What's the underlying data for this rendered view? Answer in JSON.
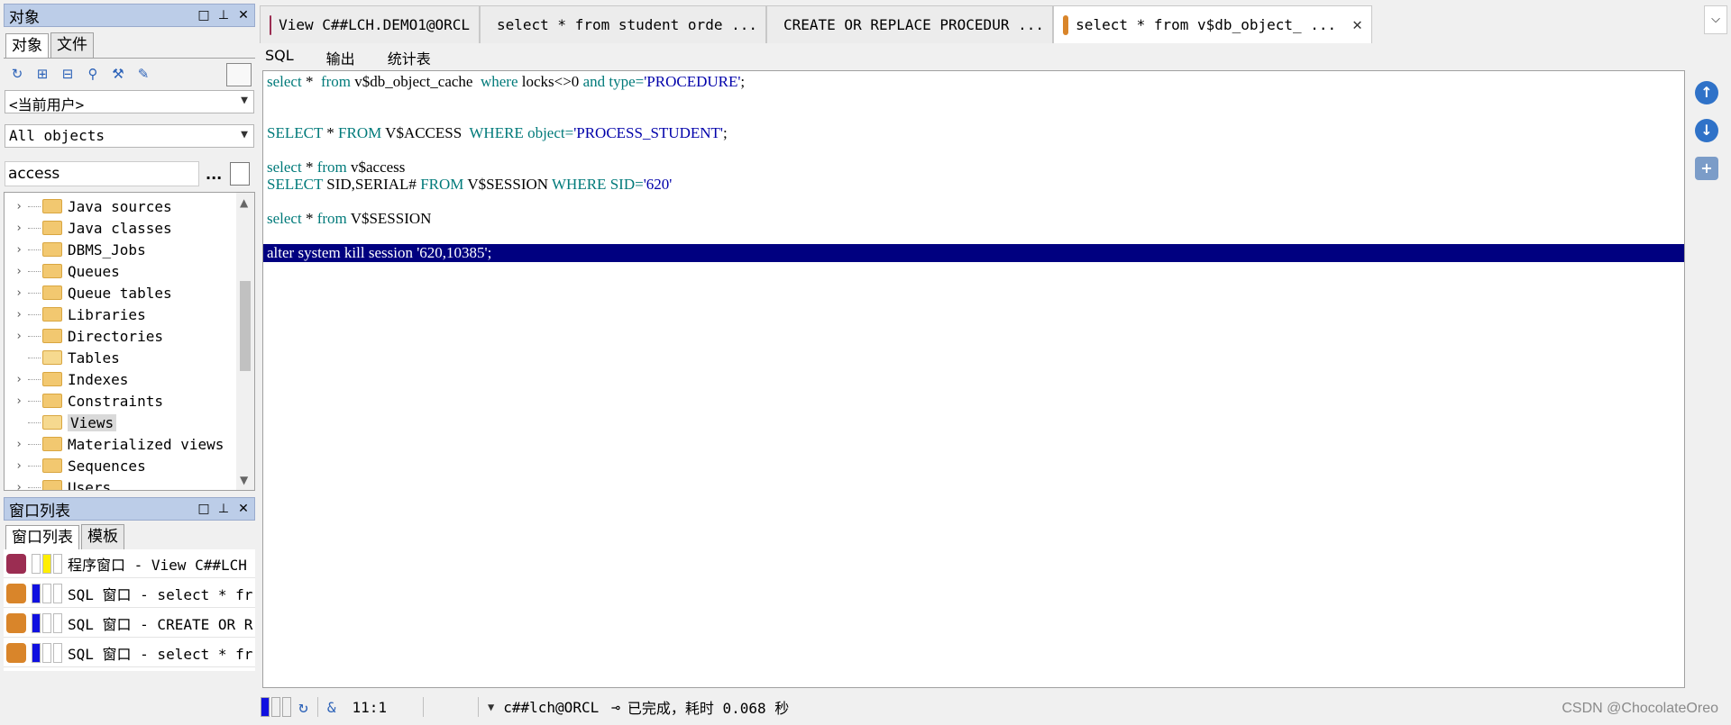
{
  "objects_panel": {
    "title": "对象",
    "controls": [
      "□",
      "⊥",
      "✕"
    ],
    "tabs": [
      {
        "label": "对象",
        "active": true
      },
      {
        "label": "文件",
        "active": false
      }
    ],
    "user_select": "<当前用户>",
    "type_select": "All objects",
    "search_value": "access",
    "search_dots": "...",
    "tree_items": [
      {
        "label": "Java sources",
        "expandable": true,
        "open": false,
        "selected": false
      },
      {
        "label": "Java classes",
        "expandable": true,
        "open": false,
        "selected": false
      },
      {
        "label": "DBMS_Jobs",
        "expandable": true,
        "open": false,
        "selected": false
      },
      {
        "label": "Queues",
        "expandable": true,
        "open": false,
        "selected": false
      },
      {
        "label": "Queue tables",
        "expandable": true,
        "open": false,
        "selected": false
      },
      {
        "label": "Libraries",
        "expandable": true,
        "open": false,
        "selected": false
      },
      {
        "label": "Directories",
        "expandable": true,
        "open": false,
        "selected": false
      },
      {
        "label": "Tables",
        "expandable": false,
        "open": true,
        "selected": false
      },
      {
        "label": "Indexes",
        "expandable": true,
        "open": false,
        "selected": false
      },
      {
        "label": "Constraints",
        "expandable": true,
        "open": false,
        "selected": false
      },
      {
        "label": "Views",
        "expandable": false,
        "open": true,
        "selected": true
      },
      {
        "label": "Materialized views",
        "expandable": true,
        "open": false,
        "selected": false
      },
      {
        "label": "Sequences",
        "expandable": true,
        "open": false,
        "selected": false
      },
      {
        "label": "Users",
        "expandable": true,
        "open": false,
        "selected": false
      }
    ]
  },
  "window_list_panel": {
    "title": "窗口列表",
    "controls": [
      "□",
      "⊥",
      "✕"
    ],
    "tabs": [
      {
        "label": "窗口列表",
        "active": true
      },
      {
        "label": "模板",
        "active": false
      }
    ],
    "rows": [
      {
        "text": "程序窗口 - View C##LCH",
        "icon_color": "#9b2d52",
        "swatch": "#ffee00"
      },
      {
        "text": "SQL 窗口 - select * fr",
        "icon_color": "#d9852a",
        "swatch": "#1010e0"
      },
      {
        "text": "SQL 窗口 - CREATE OR R",
        "icon_color": "#d9852a",
        "swatch": "#1010e0"
      },
      {
        "text": "SQL 窗口 - select * fr",
        "icon_color": "#d9852a",
        "swatch": "#1010e0"
      }
    ]
  },
  "editor_tabs": [
    {
      "label": "View C##LCH.DEMO1@ORCL",
      "icon_color": "#9b2d52",
      "active": false
    },
    {
      "label": "select * from student orde ...",
      "icon_color": "#d9852a",
      "active": false
    },
    {
      "label": "CREATE OR REPLACE PROCEDUR ...",
      "icon_color": "#d9852a",
      "active": false
    },
    {
      "label": "select * from v$db_object_ ...",
      "icon_color": "#d9852a",
      "active": true
    }
  ],
  "editor_tab_close": "✕",
  "sub_tabs": [
    {
      "label": "SQL"
    },
    {
      "label": "输出"
    },
    {
      "label": "统计表"
    }
  ],
  "code": {
    "line1": {
      "a": "select",
      "b": " * ",
      "c": " from",
      "d": " v$db_object_cache  ",
      "e": "where",
      "f": " locks<>0 ",
      "g": "and",
      "h": " type=",
      "i": "'PROCEDURE'",
      "j": ";"
    },
    "line2": {
      "a": "SELECT",
      "b": " * ",
      "c": "FROM",
      "d": " V$ACCESS  ",
      "e": "WHERE",
      "f": " object=",
      "g": "'PROCESS_STUDENT'",
      "h": ";"
    },
    "line3": {
      "a": "select",
      "b": " * ",
      "c": "from",
      "d": " v$access"
    },
    "line4": {
      "a": "SELECT",
      "b": " SID,SERIAL# ",
      "c": "FROM",
      "d": " V$SESSION ",
      "e": "WHERE",
      "f": " SID=",
      "g": "'620'"
    },
    "line5": {
      "a": "select",
      "b": " * ",
      "c": "from",
      "d": " V$SESSION"
    },
    "line6": "alter system kill session '620,10385';"
  },
  "status_bar": {
    "cursor": "11:1",
    "amp": "&",
    "connection": "c##lch@ORCL",
    "message": "已完成，耗时 0.068 秒"
  },
  "watermark": "CSDN @ChocolateOreo",
  "colors": {
    "keyword": "#007a7a",
    "string": "#0000aa",
    "highlight_bg": "#000080",
    "panel_title_bg": "#bccde8"
  }
}
